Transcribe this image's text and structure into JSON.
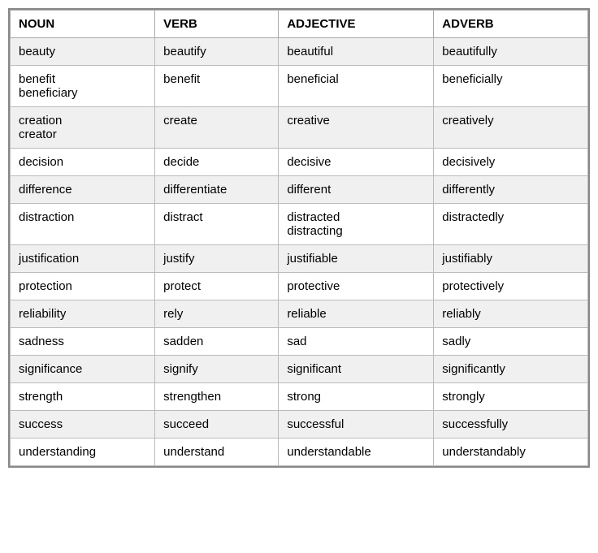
{
  "table": {
    "headers": [
      "NOUN",
      "VERB",
      "ADJECTIVE",
      "ADVERB"
    ],
    "rows": [
      {
        "noun": "beauty",
        "verb": "beautify",
        "adjective": "beautiful",
        "adverb": "beautifully"
      },
      {
        "noun": "benefit\nbeneficiary",
        "verb": "benefit",
        "adjective": "beneficial",
        "adverb": "beneficially"
      },
      {
        "noun": "creation\ncreator",
        "verb": "create",
        "adjective": "creative",
        "adverb": "creatively"
      },
      {
        "noun": "decision",
        "verb": "decide",
        "adjective": "decisive",
        "adverb": "decisively"
      },
      {
        "noun": "difference",
        "verb": "differentiate",
        "adjective": "different",
        "adverb": "differently"
      },
      {
        "noun": "distraction",
        "verb": "distract",
        "adjective": "distracted\ndistracting",
        "adverb": "distractedly"
      },
      {
        "noun": "justification",
        "verb": "justify",
        "adjective": "justifiable",
        "adverb": "justifiably"
      },
      {
        "noun": "protection",
        "verb": "protect",
        "adjective": "protective",
        "adverb": "protectively"
      },
      {
        "noun": "reliability",
        "verb": "rely",
        "adjective": "reliable",
        "adverb": "reliably"
      },
      {
        "noun": "sadness",
        "verb": "sadden",
        "adjective": "sad",
        "adverb": "sadly"
      },
      {
        "noun": "significance",
        "verb": "signify",
        "adjective": "significant",
        "adverb": "significantly"
      },
      {
        "noun": "strength",
        "verb": "strengthen",
        "adjective": "strong",
        "adverb": "strongly"
      },
      {
        "noun": "success",
        "verb": "succeed",
        "adjective": "successful",
        "adverb": "successfully"
      },
      {
        "noun": "understanding",
        "verb": "understand",
        "adjective": "understandable",
        "adverb": "understandably"
      }
    ]
  }
}
